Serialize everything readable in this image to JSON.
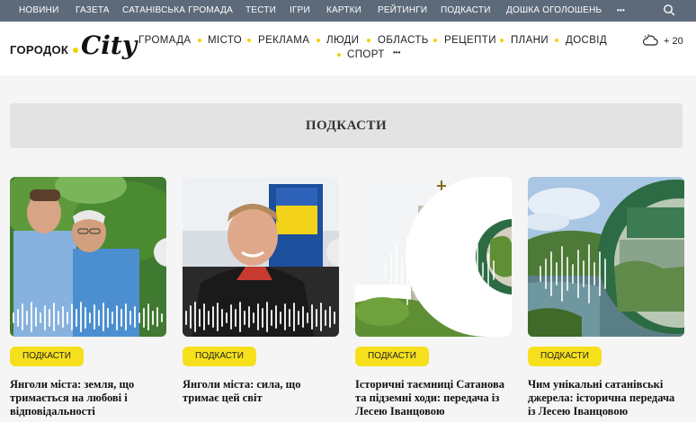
{
  "top_nav": [
    "НОВИНИ",
    "ГАЗЕТА",
    "САТАНІВСЬКА ГРОМАДА",
    "ТЕСТИ",
    "ІГРИ",
    "КАРТКИ",
    "РЕЙТИНГИ",
    "ПОДКАСТИ",
    "ДОШКА ОГОЛОШЕНЬ",
    "•••"
  ],
  "logo": {
    "word": "ГОРОДОК",
    "script": "City"
  },
  "main_menu": [
    "ГРОМАДА",
    "МІСТО",
    "РЕКЛАМА",
    "ЛЮДИ",
    "ОБЛАСТЬ",
    "РЕЦЕПТИ",
    "ПЛАНИ",
    "ДОСВІД",
    "СПОРТ",
    "•••"
  ],
  "weather": {
    "icon": "cloud-icon",
    "temp": "+ 20"
  },
  "page_title": "ПОДКАСТИ",
  "cards": [
    {
      "tag": "ПОДКАСТИ",
      "title": "Янголи міста: земля, що тримається на любові і відповідальності"
    },
    {
      "tag": "ПОДКАСТИ",
      "title": "Янголи міста: сила, що тримає цей світ"
    },
    {
      "tag": "ПОДКАСТИ",
      "title": "Історичні таємниці Сатанова та підземні ходи: передача із Лесею Іванцовою"
    },
    {
      "tag": "ПОДКАСТИ",
      "title": "Чим унікальні сатанівські джерела: історична передача із Лесею Іванцовою"
    }
  ],
  "colors": {
    "accent": "#f6e01c",
    "topbar": "#5d6a7a",
    "green": "#2c6b43"
  }
}
